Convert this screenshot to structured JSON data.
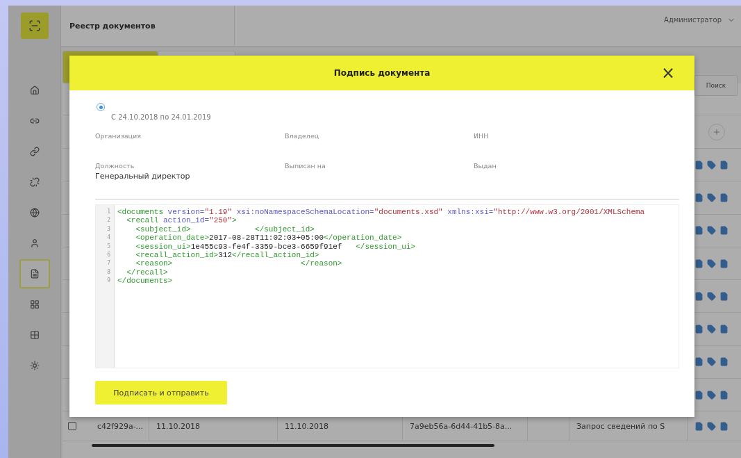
{
  "header": {
    "title": "Реестр документов",
    "user": "Администратор"
  },
  "sidebar": {
    "items": [
      {
        "selected": false
      },
      {
        "selected": false
      },
      {
        "selected": false
      },
      {
        "selected": false
      },
      {
        "selected": false
      },
      {
        "selected": false
      },
      {
        "selected": true
      },
      {
        "selected": false
      },
      {
        "selected": false
      },
      {
        "selected": false
      }
    ]
  },
  "toolbar": {
    "search_button": "Поиск"
  },
  "table": {
    "rows": [
      {
        "checked": false,
        "cells": [
          "c42f929a-...",
          "11.10.2018",
          "11.10.2018",
          "7a9eb56a-6d44-41b5-8a...",
          "Запрос сведений по S"
        ]
      }
    ]
  },
  "dialog": {
    "title": "Подпись документа",
    "close": "×",
    "certificate": {
      "selected": true,
      "period": "С 24.10.2018 по 24.01.2019"
    },
    "fields": [
      {
        "label": "Организация"
      },
      {
        "label": "Владелец"
      },
      {
        "label": "ИНН"
      },
      {
        "label": "Должность",
        "value": "Генеральный директор"
      },
      {
        "label": "Выписан на"
      },
      {
        "label": "Выдан"
      }
    ],
    "xml_lines": [
      {
        "number": "1",
        "tokens": [
          {
            "kind": "tag",
            "text": "<documents"
          },
          {
            "kind": "attr",
            "text": " version="
          },
          {
            "kind": "value",
            "text": "\"1.19\""
          },
          {
            "kind": "attr",
            "text": " xsi:noNamespaceSchemaLocation="
          },
          {
            "kind": "value",
            "text": "\"documents.xsd\""
          },
          {
            "kind": "attr",
            "text": " xmlns:xsi="
          },
          {
            "kind": "value",
            "text": "\"http://www.w3.org/2001/XMLSchema"
          }
        ]
      },
      {
        "number": "2",
        "tokens": [
          {
            "kind": "tag",
            "text": "  <recall"
          },
          {
            "kind": "attr",
            "text": " action_id="
          },
          {
            "kind": "value",
            "text": "\"250\""
          },
          {
            "kind": "tag",
            "text": ">"
          }
        ]
      },
      {
        "number": "3",
        "tokens": [
          {
            "kind": "tag",
            "text": "    <subject_id>"
          },
          {
            "kind": "tag",
            "text": "              </subject_id>"
          }
        ]
      },
      {
        "number": "4",
        "tokens": [
          {
            "kind": "tag",
            "text": "    <operation_date>"
          },
          {
            "kind": "text",
            "text": "2017-08-28T11:02:03+05:00"
          },
          {
            "kind": "tag",
            "text": "</operation_date>"
          }
        ]
      },
      {
        "number": "5",
        "tokens": [
          {
            "kind": "tag",
            "text": "    <session_ui>"
          },
          {
            "kind": "text",
            "text": "1e455c93-fe4f-3359-bce3-6659f91ef"
          },
          {
            "kind": "tag",
            "text": "   </session_ui>"
          }
        ]
      },
      {
        "number": "6",
        "tokens": [
          {
            "kind": "tag",
            "text": "    <recall_action_id>"
          },
          {
            "kind": "text",
            "text": "312"
          },
          {
            "kind": "tag",
            "text": "</recall_action_id>"
          }
        ]
      },
      {
        "number": "7",
        "tokens": [
          {
            "kind": "tag",
            "text": "    <reason>"
          },
          {
            "kind": "tag",
            "text": "                            </reason>"
          }
        ]
      },
      {
        "number": "8",
        "tokens": [
          {
            "kind": "tag",
            "text": "  </recall>"
          }
        ]
      },
      {
        "number": "9",
        "tokens": [
          {
            "kind": "tag",
            "text": "</documents>"
          }
        ]
      }
    ],
    "submit": "Подписать и отправить"
  }
}
